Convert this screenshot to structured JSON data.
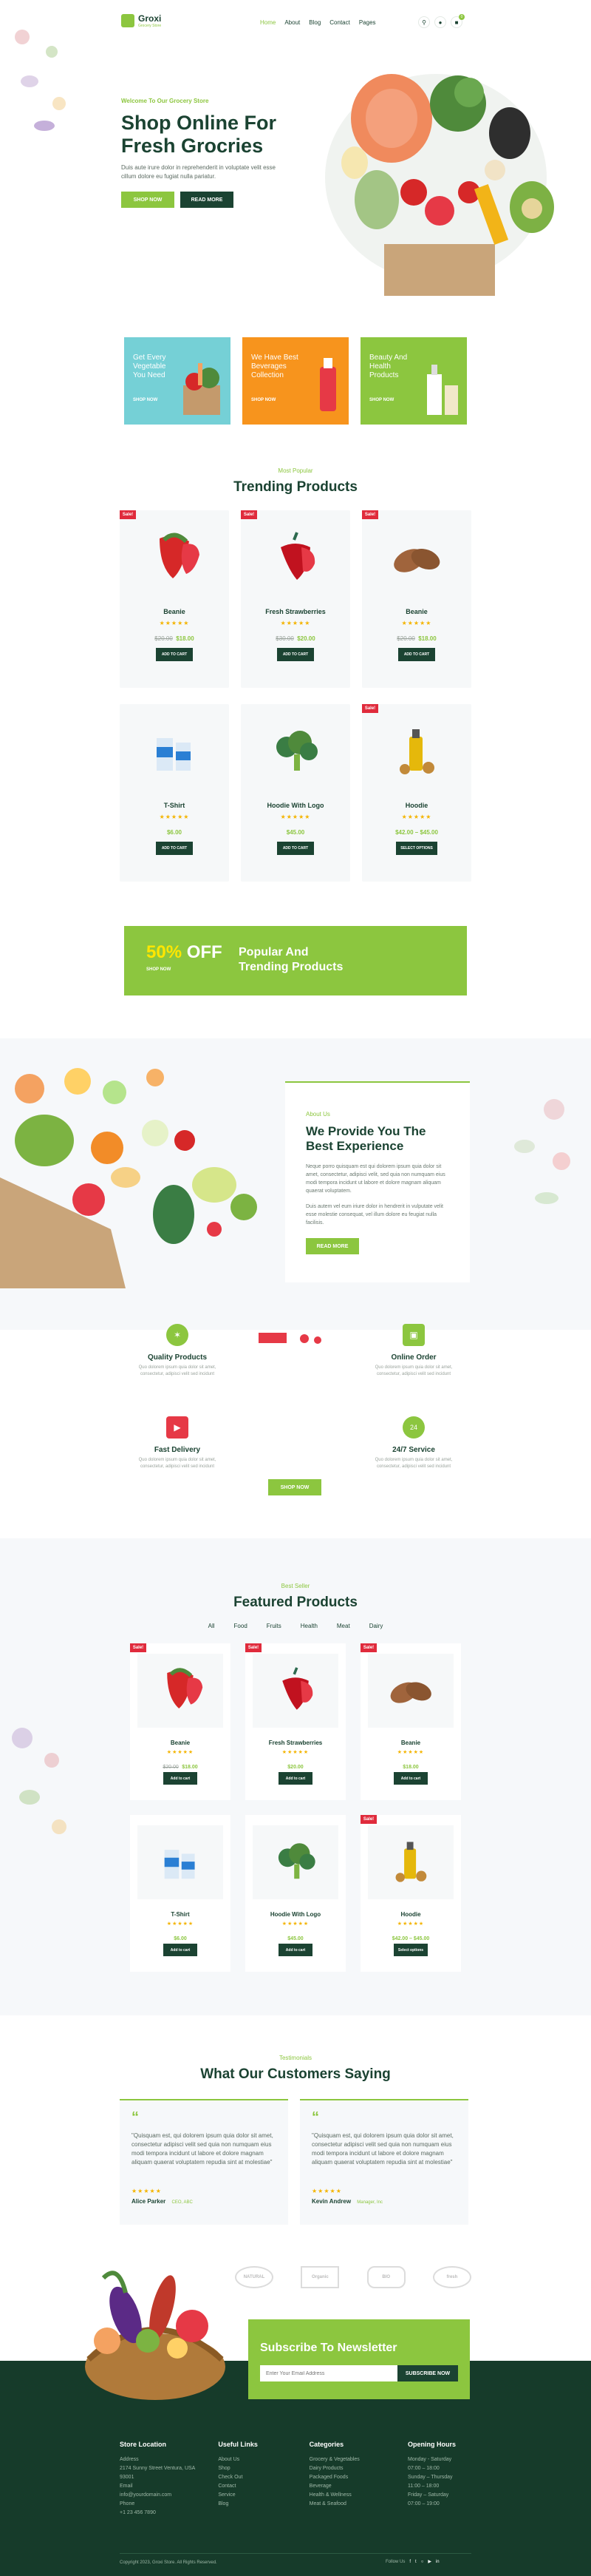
{
  "header": {
    "brand": "Groxi",
    "brand_sub": "Grocery Store",
    "nav": [
      "Home",
      "About",
      "Blog",
      "Contact",
      "Pages"
    ],
    "cart_count": "0"
  },
  "hero": {
    "kicker": "Welcome To Our Grocery Store",
    "title_line1": "Shop Online For",
    "title_line2": "Fresh Grocries",
    "desc": "Duis aute irure dolor in reprehenderit in voluptate velit esse cillum dolore eu fugiat nulla pariatur.",
    "btn_primary": "SHOP NOW",
    "btn_secondary": "READ MORE"
  },
  "promo_cards": [
    {
      "text": "Get Every Vegetable You Need",
      "link": "SHOP NOW",
      "bg": "#75d0d6"
    },
    {
      "text": "We Have Best Beverages Collection",
      "link": "SHOP NOW",
      "bg": "#f7941d"
    },
    {
      "text": "Beauty And Health Products",
      "link": "SHOP NOW",
      "bg": "#8cc63f"
    }
  ],
  "trending": {
    "sub": "Most Popular",
    "title": "Trending Products",
    "items": [
      {
        "name": "Beanie",
        "old": "$20.00",
        "price": "$18.00",
        "btn": "ADD TO CART",
        "sale": true,
        "img": "strawberry",
        "rating": 5
      },
      {
        "name": "Fresh Strawberries",
        "old": "$30.00",
        "price": "$20.00",
        "btn": "ADD TO CART",
        "sale": true,
        "img": "pepper",
        "rating": 5
      },
      {
        "name": "Beanie",
        "old": "$20.00",
        "price": "$18.00",
        "btn": "ADD TO CART",
        "sale": true,
        "img": "potato",
        "rating": 5
      },
      {
        "name": "T-Shirt",
        "old": "",
        "price": "$6.00",
        "btn": "ADD TO CART",
        "sale": false,
        "img": "milk",
        "rating": 5
      },
      {
        "name": "Hoodie With Logo",
        "old": "",
        "price": "$45.00",
        "btn": "ADD TO CART",
        "sale": false,
        "img": "broccoli",
        "rating": 5
      },
      {
        "name": "Hoodie",
        "old": "",
        "price": "$42.00 – $45.00",
        "btn": "SELECT OPTIONS",
        "sale": true,
        "img": "oil",
        "rating": 5
      }
    ],
    "sale_label": "Sale!"
  },
  "banner": {
    "percent": "50%",
    "off": "OFF",
    "link": "SHOP NOW",
    "line1": "Popular And",
    "line2": "Trending Products"
  },
  "about": {
    "sub": "About Us",
    "title_line1": "We Provide You The",
    "title_line2": "Best Experience",
    "p1": "Neque porro quisquam est qui dolorem ipsum quia dolor sit amet, consectetur, adipisci velit, sed quia non numquam eius modi tempora incidunt ut labore et dolore magnam aliquam quaerat voluptatem.",
    "p2": "Duis autem vel eum iriure dolor in hendrerit in vulputate velit esse molestie consequat, vel illum dolore eu feugiat nulla facilisis.",
    "btn": "READ MORE"
  },
  "features": [
    {
      "title": "Quality Products",
      "desc": "Quo dolorem ipsum quia dolor sit amet, consectetur, adipisci velit sed incidunt"
    },
    {
      "title": "Online Order",
      "desc": "Quo dolorem ipsum quia dolor sit amet, consectetur, adipisci velit sed incidunt"
    },
    {
      "title": "Fast Delivery",
      "desc": "Quo dolorem ipsum quia dolor sit amet, consectetur, adipisci velit sed incidunt"
    },
    {
      "title": "24/7 Service",
      "desc": "Quo dolorem ipsum quia dolor sit amet, consectetur, adipisci velit sed incidunt"
    }
  ],
  "features_btn": "SHOP NOW",
  "featured": {
    "sub": "Best Seller",
    "title": "Featured Products",
    "tabs": [
      "All",
      "Food",
      "Fruits",
      "Health",
      "Meat",
      "Dairy"
    ],
    "items": [
      {
        "name": "Beanie",
        "old": "$20.00",
        "price": "$18.00",
        "btn": "Add to cart",
        "sale": true,
        "img": "strawberry"
      },
      {
        "name": "Fresh Strawberries",
        "old": "",
        "price": "$20.00",
        "btn": "Add to cart",
        "sale": true,
        "img": "pepper"
      },
      {
        "name": "Beanie",
        "old": "",
        "price": "$18.00",
        "btn": "Add to cart",
        "sale": true,
        "img": "potato"
      },
      {
        "name": "T-Shirt",
        "old": "",
        "price": "$6.00",
        "btn": "Add to cart",
        "sale": false,
        "img": "milk"
      },
      {
        "name": "Hoodie With Logo",
        "old": "",
        "price": "$45.00",
        "btn": "Add to cart",
        "sale": false,
        "img": "broccoli"
      },
      {
        "name": "Hoodie",
        "old": "",
        "price": "$42.00 – $45.00",
        "btn": "Select options",
        "sale": true,
        "img": "oil"
      }
    ],
    "sale_label": "Sale!"
  },
  "testimonials": {
    "sub": "Testimonials",
    "title": "What Our Customers Saying",
    "items": [
      {
        "quote": "\"Quisquam est, qui dolorem ipsum quia dolor sit amet, consectetur adipisci velit sed quia non numquam eius modi tempora incidunt ut labore et dolore magnam aliquam quaerat voluptatem repudia sint at molestiae\"",
        "name": "Alice Parker",
        "role": "CEO, ABC"
      },
      {
        "quote": "\"Quisquam est, qui dolorem ipsum quia dolor sit amet, consectetur adipisci velit sed quia non numquam eius modi tempora incidunt ut labore et dolore magnam aliquam quaerat voluptatem repudia sint at molestiae\"",
        "name": "Kevin Andrew",
        "role": "Manager, Inc"
      }
    ]
  },
  "brands": [
    "NATURAL",
    "Organic",
    "BIO",
    "fresh"
  ],
  "newsletter": {
    "title": "Subscribe To Newsletter",
    "placeholder": "Enter Your Email Address",
    "btn": "SUBSCRIBE NOW"
  },
  "footer": {
    "cols": [
      {
        "title": "Store Location",
        "lines": [
          "Address",
          "2174 Sunny Street Ventura, USA 93001",
          "Email",
          "info@yourdomain.com",
          "Phone",
          "+1 23 456 7890"
        ]
      },
      {
        "title": "Useful Links",
        "lines": [
          "About Us",
          "Shop",
          "Check Out",
          "Contact",
          "Service",
          "Blog"
        ]
      },
      {
        "title": "Categories",
        "lines": [
          "Grocery & Vegetables",
          "Dairy Products",
          "Packaged Foods",
          "Beverage",
          "Health & Wellness",
          "Meat & Seafood"
        ]
      },
      {
        "title": "Opening Hours",
        "lines": [
          "Monday - Saturday",
          "07:00 – 18:00",
          "Sunday – Thursday",
          "11:00 – 18:00",
          "Friday – Saturday",
          "07:00 – 19:00"
        ]
      }
    ],
    "copyright": "Copyright 2023, Groxi Store. All Rights Reserved.",
    "follow": "Follow Us"
  },
  "colors": {
    "green": "#8cc63f",
    "dark": "#1b4332",
    "red": "#e02b3c"
  }
}
